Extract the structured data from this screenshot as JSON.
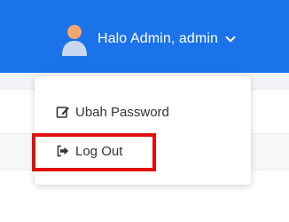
{
  "header": {
    "user_label": "Halo Admin, admin",
    "background_color": "#1a73e8",
    "avatar_icon": "user-avatar-icon",
    "chevron_icon": "chevron-down-icon"
  },
  "dropdown": {
    "items": [
      {
        "label": "Ubah Password",
        "icon": "edit-icon"
      },
      {
        "label": "Log Out",
        "icon": "sign-out-icon"
      }
    ]
  },
  "annotation": {
    "highlight_color": "#e10e0e",
    "highlighted_item": "Log Out"
  }
}
